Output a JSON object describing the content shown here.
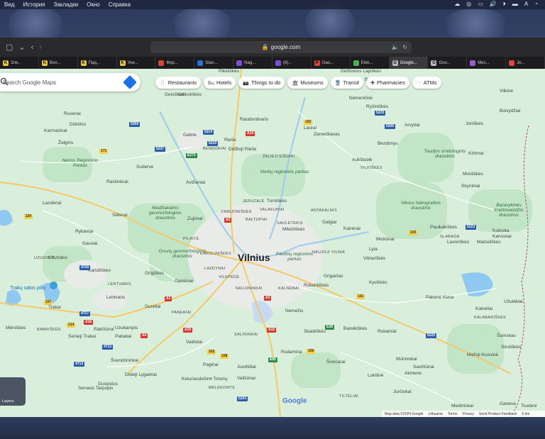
{
  "menubar": {
    "items": [
      "Вид",
      "История",
      "Закладки",
      "Окно",
      "Справка"
    ]
  },
  "browser": {
    "url": "google.com",
    "tabs": [
      {
        "label": "Зле..",
        "fav": "K",
        "color": "#e8c547"
      },
      {
        "label": "Вол...",
        "fav": "K",
        "color": "#e8c547"
      },
      {
        "label": "Пад...",
        "fav": "K",
        "color": "#e8c547"
      },
      {
        "label": "Уни...",
        "fav": "K",
        "color": "#e8c547"
      },
      {
        "label": "Фор...",
        "fav": "",
        "color": "#d8453b"
      },
      {
        "label": "Stan...",
        "fav": "",
        "color": "#2f6fd6"
      },
      {
        "label": "Nag...",
        "fav": "",
        "color": "#7b4fd0"
      },
      {
        "label": "(6)...",
        "fav": "",
        "color": "#7b4fd0"
      },
      {
        "label": "Gau...",
        "fav": "P",
        "color": "#d8453b"
      },
      {
        "label": "Elek...",
        "fav": "",
        "color": "#4caf50"
      },
      {
        "label": "Google...",
        "fav": "G",
        "color": "#bbbbbb"
      },
      {
        "label": "Goo...",
        "fav": "G",
        "color": "#bbbbbb"
      },
      {
        "label": "Mes...",
        "fav": "",
        "color": "#9b59d6"
      },
      {
        "label": "Je...",
        "fav": "",
        "color": "#d8453b"
      }
    ]
  },
  "search": {
    "placeholder": "Search Google Maps"
  },
  "chips": [
    {
      "icon": "fork-knife-icon",
      "glyph": "🍴",
      "label": "Restaurants"
    },
    {
      "icon": "bed-icon",
      "glyph": "🛏",
      "label": "Hotels"
    },
    {
      "icon": "camera-icon",
      "glyph": "📷",
      "label": "Things to do"
    },
    {
      "icon": "museum-icon",
      "glyph": "🏛",
      "label": "Museums"
    },
    {
      "icon": "train-icon",
      "glyph": "🚆",
      "label": "Transit"
    },
    {
      "icon": "pharmacy-icon",
      "glyph": "✚",
      "label": "Pharmacies"
    },
    {
      "icon": "atm-icon",
      "glyph": "···",
      "label": "ATMs"
    }
  ],
  "map": {
    "city": "Vilnius",
    "places": [
      "Kalikstiškės",
      "Geisiškės",
      "Rusenai",
      "Dūkštos",
      "Karmazinai",
      "Žalgiris",
      "Raudondvaris",
      "Galinė",
      "Rieše",
      "Didžioji Rieše",
      "Suderve",
      "Avižieniai",
      "Rastinėnai",
      "Lazdėnai",
      "Sėlenai",
      "Zujūnai",
      "Rykantai",
      "Sausiai",
      "Kariotiškės",
      "Grigiškės",
      "Užutrakis",
      "Trakai",
      "Lentvaris",
      "Gureliai",
      "Ganiūnai",
      "Mikniškės",
      "Uzukampis",
      "Pabaliai",
      "Senieji Trakai",
      "Rakčiūnai",
      "Vaidotai",
      "Pagiriai",
      "Juodšiliai",
      "Valčiūnai",
      "Didieji Lygainiai",
      "Keturiasdešimt Totorių",
      "Guopstos",
      "Senasis Tarpupis",
      "Švendrininkai",
      "Rudamina",
      "Šveicarai",
      "Lukšinė",
      "Jurčiukai",
      "Akmenė",
      "Savičiūnai",
      "Mūrininkai",
      "Rukainiai",
      "Bareikiškės",
      "Skaidiškės",
      "Nemežis",
      "Rokantiškės",
      "Grigaičiai",
      "Kyviškės",
      "Viktariškės",
      "Lyia",
      "Mickūnai",
      "Kairėnai",
      "Galgiai",
      "Mileišiškės",
      "Turniškės",
      "Pikeliškės",
      "Didžiosios Lapiškės",
      "Balingrados",
      "Nemenčinė",
      "Ryšiniškės",
      "Laurai",
      "Zamečkavas",
      "Bezdonys",
      "Arvydai",
      "Aukštuolė",
      "Vilkinė",
      "Buivydžiai",
      "Joniškės",
      "Kirtimai",
      "Mostiškės",
      "Skynimai",
      "Paulkakiškės",
      "Lavoriškės",
      "Kotovka",
      "Karvosiai",
      "Mačiuliškės",
      "Pakenė",
      "Kena",
      "Kalveliai",
      "Užutėkiai",
      "Šumskas",
      "Sirutiškės",
      "Mažoji Kuosinė",
      "Medininkai",
      "Ganeva",
      "Tsudeni"
    ],
    "caps_places": [
      "VILKIŠKĖS",
      "KAROLINIŠKĖS",
      "LAZDYNAI",
      "VILKPĖDĖ",
      "NAUJININKAI",
      "KALNĖNAI",
      "ANTAKALNIS",
      "SAULĖTEKIS",
      "NAUJOJI VILNIA",
      "BALTUPIAI",
      "JERUZALĖ",
      "FABIJONIŠKĖS",
      "VALAKUPIAI",
      "PILAITĖ",
      "LENTVARIS",
      "BABRIŠKĖS",
      "SALININKAI",
      "MELEKONYS",
      "TILTELIAI",
      "KALABARIŠKĖS",
      "SLABADA",
      "ŽALIEJI EŽERAI",
      "UZUGIRIS",
      "BENDORIAI",
      "PANERIAI"
    ],
    "parks": [
      "Nerios Regioninis Parkas",
      "Verkių regioninis parkas",
      "Medžiakalnio geomorfologinis draustinis",
      "Grovių geomorfologinis draustinis",
      "Pavilnių regioninis parkas",
      "Vilnios hidrografinis draustinis",
      "Taurijos ornitologinis draustinis",
      "Baravykinės kraštovaizdžio draustinis"
    ],
    "lake": "Trakų salos pilis",
    "roads": [
      "A14",
      "A1",
      "A2",
      "A3",
      "A4",
      "A15",
      "A16",
      "A19",
      "E28",
      "E85",
      "E272",
      "102",
      "103",
      "106",
      "107",
      "171",
      "202",
      "214",
      "220",
      "5206",
      "5210",
      "5214",
      "5220",
      "5223",
      "5225",
      "5237",
      "5259",
      "4727",
      "4729",
      "4712",
      "4713",
      "5203",
      "108",
      "101"
    ]
  },
  "layers_label": "Layers",
  "google_logo": "Google",
  "attribution": [
    "Map data ©2024 Google",
    "Lithuania",
    "Terms",
    "Privacy",
    "Send Product Feedback",
    "5 km"
  ]
}
